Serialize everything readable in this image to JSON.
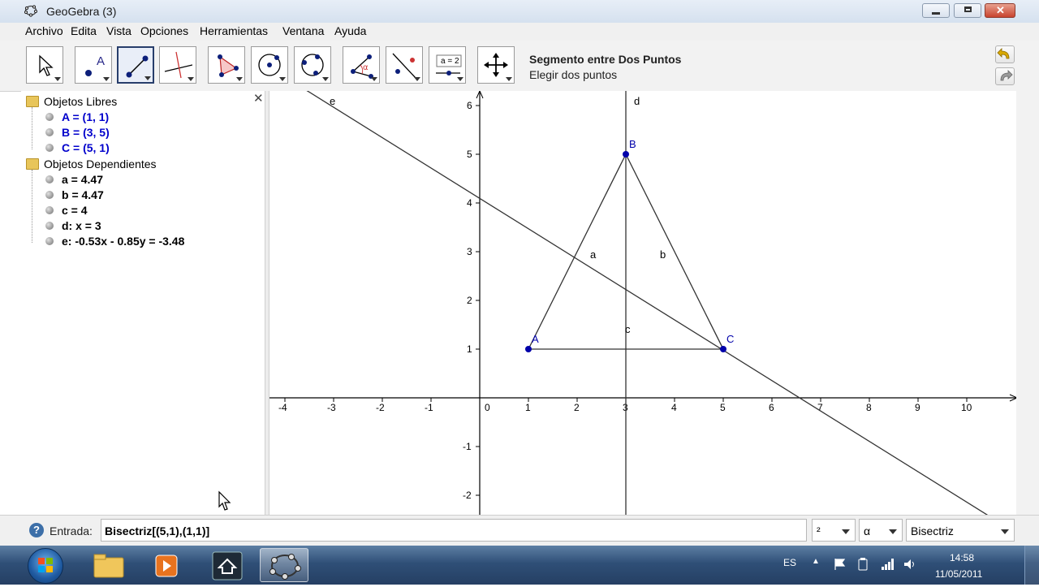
{
  "window": {
    "title": "GeoGebra (3)"
  },
  "menu": [
    "Archivo",
    "Edita",
    "Vista",
    "Opciones",
    "Herramientas",
    "Ventana",
    "Ayuda"
  ],
  "toolbar": {
    "tools": [
      {
        "name": "move-tool"
      },
      {
        "name": "new-point-tool"
      },
      {
        "name": "segment-tool",
        "active": true
      },
      {
        "name": "perpendicular-line-tool"
      },
      {
        "name": "polygon-tool"
      },
      {
        "name": "circle-tool"
      },
      {
        "name": "conic-tool"
      },
      {
        "name": "angle-tool"
      },
      {
        "name": "reflect-tool"
      },
      {
        "name": "slider-tool",
        "text": "a = 2"
      },
      {
        "name": "move-graphics-tool"
      }
    ],
    "active_title": "Segmento entre Dos Puntos",
    "active_help": "Elegir dos puntos"
  },
  "algebra": {
    "free_label": "Objetos Libres",
    "free": [
      "A = (1, 1)",
      "B = (3, 5)",
      "C = (5, 1)"
    ],
    "dependent_label": "Objetos Dependientes",
    "dependent": [
      "a = 4.47",
      "b = 4.47",
      "c = 4",
      "d: x = 3",
      "e: -0.53x - 0.85y = -3.48"
    ],
    "free_color": "#0000cc",
    "dependent_color": "#000000"
  },
  "graphics": {
    "x_ticks": [
      "-4",
      "-3",
      "-2",
      "-1",
      "0",
      "1",
      "2",
      "3",
      "4",
      "5",
      "6",
      "7",
      "8",
      "9",
      "10"
    ],
    "y_ticks": [
      "6",
      "5",
      "4",
      "3",
      "2",
      "1",
      "-1",
      "-2"
    ],
    "points": [
      {
        "label": "A",
        "x": 1,
        "y": 1
      },
      {
        "label": "B",
        "x": 3,
        "y": 5
      },
      {
        "label": "C",
        "x": 5,
        "y": 1
      }
    ],
    "segment_labels": [
      "a",
      "b",
      "c"
    ],
    "line_labels": [
      "d",
      "e"
    ],
    "point_color": "#0000aa"
  },
  "input": {
    "label": "Entrada:",
    "value": "Bisectriz[(5,1),(1,1)]",
    "superscript_combo": "²",
    "greek_combo": "α",
    "command_combo": "Bisectriz"
  },
  "taskbar": {
    "language": "ES",
    "time": "14:58",
    "date": "11/05/2011"
  }
}
